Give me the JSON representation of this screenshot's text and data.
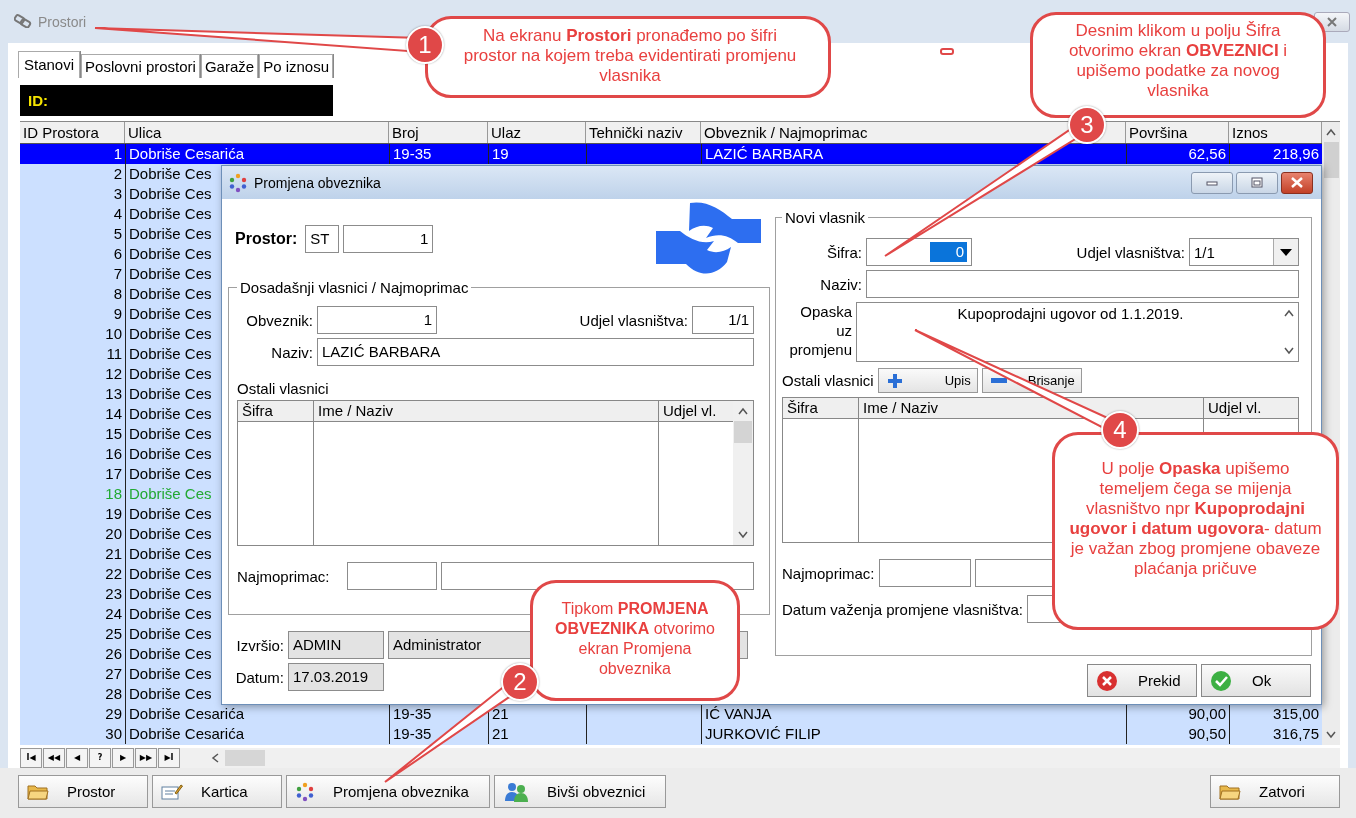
{
  "window": {
    "title": "Prostori"
  },
  "tabs": [
    {
      "label": "Stanovi",
      "selected": true
    },
    {
      "label": "Poslovni prostori",
      "selected": false
    },
    {
      "label": "Garaže",
      "selected": false
    },
    {
      "label": "Po iznosu",
      "selected": false
    }
  ],
  "id_field": {
    "label": "ID:"
  },
  "table": {
    "columns": [
      "ID Prostora",
      "Ulica",
      "Broj",
      "Ulaz",
      "Tehnički naziv",
      "Obveznik / Najmoprimac",
      "Površina",
      "Iznos"
    ],
    "rows": [
      {
        "id": "1",
        "street": "Dobriše Cesarića",
        "number": "19-35",
        "entrance": "19",
        "owner": "LAZIĆ BARBARA",
        "area": "62,56",
        "amount": "218,96",
        "selected": true,
        "highlighted": false
      },
      {
        "id": "2",
        "street": "Dobriše Ces",
        "selected": false,
        "highlighted": false
      },
      {
        "id": "3",
        "street": "Dobriše Ces",
        "selected": false,
        "highlighted": false
      },
      {
        "id": "4",
        "street": "Dobriše Ces",
        "selected": false,
        "highlighted": false
      },
      {
        "id": "5",
        "street": "Dobriše Ces",
        "selected": false,
        "highlighted": false
      },
      {
        "id": "6",
        "street": "Dobriše Ces",
        "selected": false,
        "highlighted": false
      },
      {
        "id": "7",
        "street": "Dobriše Ces",
        "selected": false,
        "highlighted": false
      },
      {
        "id": "8",
        "street": "Dobriše Ces",
        "selected": false,
        "highlighted": false
      },
      {
        "id": "9",
        "street": "Dobriše Ces",
        "selected": false,
        "highlighted": false
      },
      {
        "id": "10",
        "street": "Dobriše Ces",
        "selected": false,
        "highlighted": false
      },
      {
        "id": "11",
        "street": "Dobriše Ces",
        "selected": false,
        "highlighted": false
      },
      {
        "id": "12",
        "street": "Dobriše Ces",
        "selected": false,
        "highlighted": false
      },
      {
        "id": "13",
        "street": "Dobriše Ces",
        "selected": false,
        "highlighted": false
      },
      {
        "id": "14",
        "street": "Dobriše Ces",
        "selected": false,
        "highlighted": false
      },
      {
        "id": "15",
        "street": "Dobriše Ces",
        "selected": false,
        "highlighted": false
      },
      {
        "id": "16",
        "street": "Dobriše Ces",
        "selected": false,
        "highlighted": false
      },
      {
        "id": "17",
        "street": "Dobriše Ces",
        "selected": false,
        "highlighted": false
      },
      {
        "id": "18",
        "street": "Dobriše Ces",
        "selected": false,
        "highlighted": true
      },
      {
        "id": "19",
        "street": "Dobriše Ces",
        "selected": false,
        "highlighted": false
      },
      {
        "id": "20",
        "street": "Dobriše Ces",
        "selected": false,
        "highlighted": false
      },
      {
        "id": "21",
        "street": "Dobriše Ces",
        "selected": false,
        "highlighted": false
      },
      {
        "id": "22",
        "street": "Dobriše Ces",
        "selected": false,
        "highlighted": false
      },
      {
        "id": "23",
        "street": "Dobriše Ces",
        "selected": false,
        "highlighted": false
      },
      {
        "id": "24",
        "street": "Dobriše Ces",
        "selected": false,
        "highlighted": false
      },
      {
        "id": "25",
        "street": "Dobriše Ces",
        "selected": false,
        "highlighted": false
      },
      {
        "id": "26",
        "street": "Dobriše Ces",
        "selected": false,
        "highlighted": false
      },
      {
        "id": "27",
        "street": "Dobriše Ces",
        "selected": false,
        "highlighted": false
      },
      {
        "id": "28",
        "street": "Dobriše Ces",
        "selected": false,
        "highlighted": false
      },
      {
        "id": "29",
        "street": "Dobriše Cesarića",
        "number": "19-35",
        "entrance": "21",
        "owner": "IĆ VANJA",
        "area": "90,00",
        "amount": "315,00",
        "selected": false,
        "highlighted": false
      },
      {
        "id": "30",
        "street": "Dobriše Cesarića",
        "number": "19-35",
        "entrance": "21",
        "owner": "JURKOVIĆ FILIP",
        "area": "90,50",
        "amount": "316,75",
        "selected": false,
        "highlighted": false
      }
    ]
  },
  "pager": [
    "I◀",
    "◀◀",
    "◀",
    "?",
    "▶",
    "▶▶",
    "▶I"
  ],
  "toolbar": {
    "left": [
      {
        "label": "Prostor",
        "kind": "folder"
      },
      {
        "label": "Kartica",
        "kind": "card"
      },
      {
        "label": "Promjena obveznika",
        "kind": "cycle"
      },
      {
        "label": "Bivši obveznici",
        "kind": "people"
      }
    ],
    "right": [
      {
        "label": "Zatvori",
        "kind": "folder"
      }
    ]
  },
  "dialog": {
    "title": "Promjena obveznika",
    "prostor": {
      "label": "Prostor:",
      "type": "ST",
      "number": "1"
    },
    "current": {
      "legend": "Dosadašnji vlasnici / Najmoprimac",
      "obveznik_label": "Obveznik:",
      "obveznik": "1",
      "share_label": "Udjel vlasništva:",
      "share": "1/1",
      "name_label": "Naziv:",
      "name": "LAZIĆ BARBARA",
      "others_label": "Ostali vlasnici",
      "others_columns": [
        "Šifra",
        "Ime / Naziv",
        "Udjel vl."
      ],
      "tenant_label": "Najmoprimac:"
    },
    "executed_label": "Izvršio:",
    "executed_code": "ADMIN",
    "executed_name": "Administrator",
    "date_label": "Datum:",
    "date": "17.03.2019",
    "new_owner": {
      "legend": "Novi vlasnik",
      "code_label": "Šifra:",
      "code": "0",
      "share_label": "Udjel vlasništva:",
      "share": "1/1",
      "name_label": "Naziv:",
      "note_label": "Opaska uz promjenu",
      "note": "Kupoprodajni ugovor od 1.1.2019.",
      "others_label": "Ostali vlasnici",
      "add_button": "Upis",
      "delete_button": "Brisanje",
      "others_columns": [
        "Šifra",
        "Ime / Naziv",
        "Udjel vl."
      ],
      "tenant_label": "Najmoprimac:",
      "valid_date_label": "Datum važenja promjene vlasništva:"
    },
    "buttons": [
      {
        "label": "Prekid",
        "kind": "cancel"
      },
      {
        "label": "Ok",
        "kind": "ok"
      }
    ]
  },
  "callouts": [
    {
      "number": "1",
      "text": "Na ekranu **Prostori** pronađemo po šifri prostor na kojem treba evidentirati promjenu  vlasnika"
    },
    {
      "number": "2",
      "text": "Tipkom **PROMJENA OBVEZNIKA** otvorimo  ekran Promjena obveznika"
    },
    {
      "number": "3",
      "text": "Desnim klikom u polju Šifra otvorimo ekran **OBVEZNICI** i upišemo podatke za novog vlasnika"
    },
    {
      "number": "4",
      "text": "U polje **Opaska** upišemo temeljem čega se mijenja vlasništvo npr **Kupoprodajni ugovor i datum ugovora**- datum je važan zbog promjene obaveze plaćanja pričuve"
    }
  ]
}
